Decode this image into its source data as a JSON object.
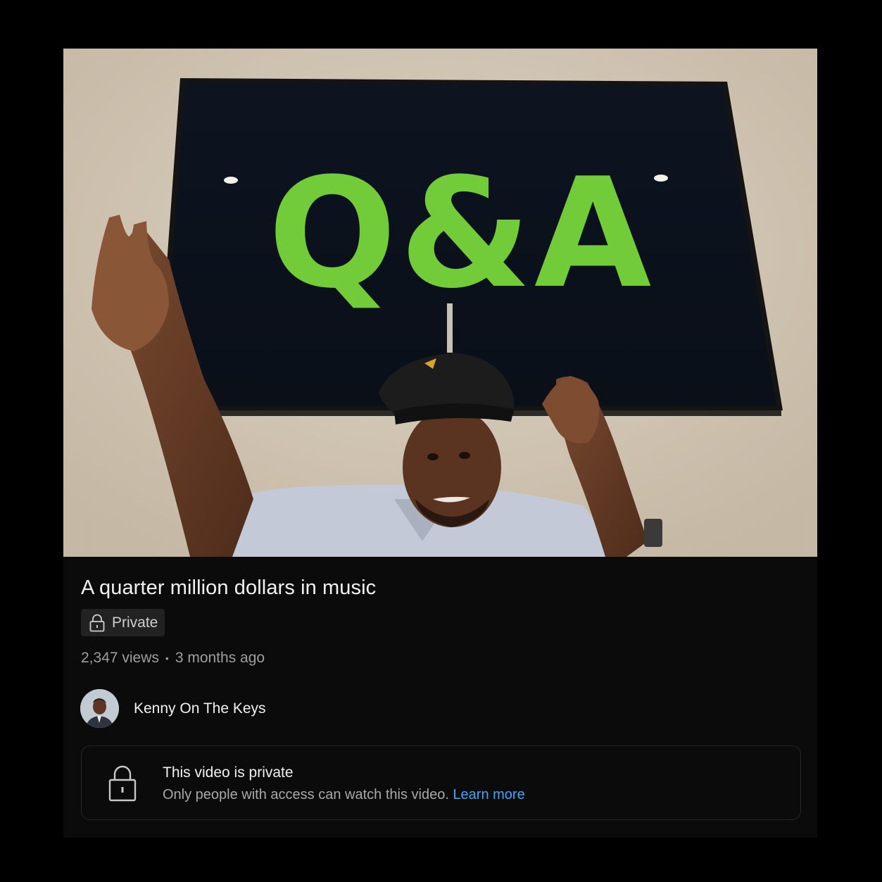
{
  "video": {
    "title": "A quarter million dollars in music",
    "thumbnail_screen_text": "Q&A",
    "privacy_label": "Private",
    "views": "2,347 views",
    "separator": "•",
    "age": "3 months ago"
  },
  "channel": {
    "name": "Kenny On The Keys"
  },
  "notice": {
    "title": "This video is private",
    "body": "Only people with access can watch this video.",
    "link_label": "Learn more"
  },
  "colors": {
    "background": "#000000",
    "card": "#0b0b0b",
    "link": "#3ea6ff",
    "tv_text": "#72cc3a"
  },
  "icons": {
    "privacy": "lock-icon",
    "notice": "lock-icon"
  }
}
